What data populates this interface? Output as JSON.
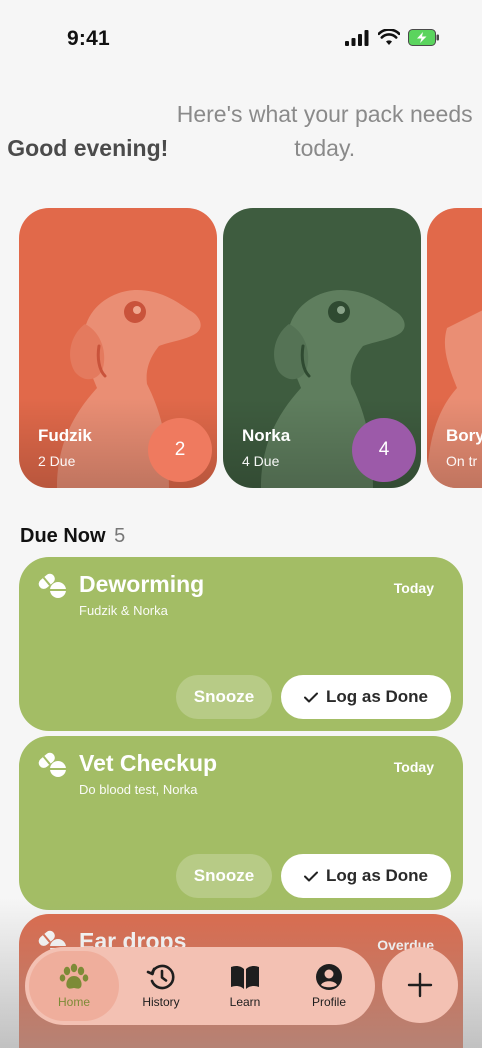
{
  "status_bar": {
    "time": "9:41"
  },
  "greeting": {
    "bold": "Good evening!",
    "rest": "Here's what your pack needs today."
  },
  "pets": [
    {
      "name": "Fudzik",
      "due": "2 Due",
      "badge": "2",
      "color": "#e1694a",
      "badge_color": "#ef7a5f"
    },
    {
      "name": "Norka",
      "due": "4 Due",
      "badge": "4",
      "color": "#3e5c3f",
      "badge_color": "#9c5aa9"
    },
    {
      "name": "Bory",
      "due": "On tr",
      "color": "#e1694a"
    }
  ],
  "due_now": {
    "title": "Due Now",
    "count": "5",
    "tasks": [
      {
        "title": "Deworming",
        "subtitle": "Fudzik & Norka",
        "when": "Today",
        "snooze": "Snooze",
        "done": "Log as Done",
        "icon": "pill-icon",
        "color": "#a3bd65"
      },
      {
        "title": "Vet Checkup",
        "subtitle": "Do blood test, Norka",
        "when": "Today",
        "snooze": "Snooze",
        "done": "Log as Done",
        "icon": "pill-icon",
        "color": "#a3bd65"
      },
      {
        "title": "Ear drops",
        "subtitle": "",
        "when": "Overdue",
        "icon": "pill-icon",
        "color": "#dc6a4c"
      }
    ]
  },
  "tab_bar": {
    "tabs": [
      {
        "label": "Home",
        "icon": "paw-icon",
        "active": true
      },
      {
        "label": "History",
        "icon": "history-icon",
        "active": false
      },
      {
        "label": "Learn",
        "icon": "book-icon",
        "active": false
      },
      {
        "label": "Profile",
        "icon": "profile-icon",
        "active": false
      }
    ],
    "fab_icon": "plus-icon"
  }
}
